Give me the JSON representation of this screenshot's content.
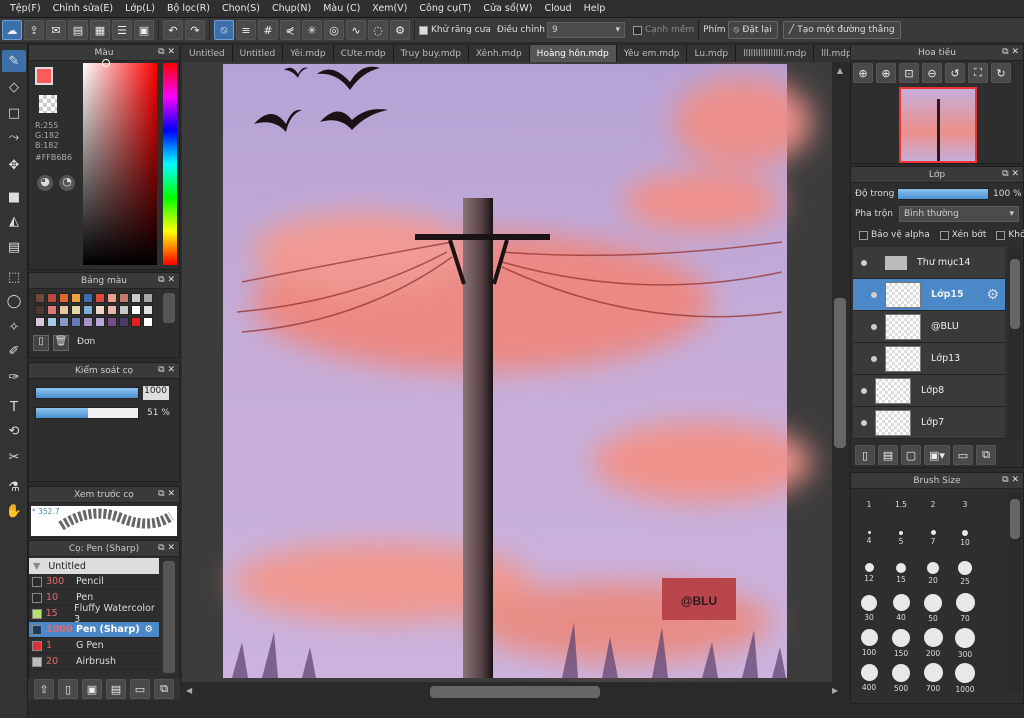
{
  "menu": [
    "Tệp(F)",
    "Chỉnh sửa(E)",
    "Lớp(L)",
    "Bộ lọc(R)",
    "Chọn(S)",
    "Chụp(N)",
    "Màu (C)",
    "Xem(V)",
    "Công cụ(T)",
    "Cửa sổ(W)",
    "Cloud",
    "Help"
  ],
  "toolbar": {
    "antialias": "Khử răng cưa",
    "adjust_label": "Điều chỉnh",
    "adjust_value": "9",
    "soft_edge": "Cạnh mềm",
    "key_label": "Phím",
    "reset": "Đặt lại",
    "straight": "Tạo một đường thẳng"
  },
  "color_panel": {
    "title": "Màu",
    "r": "R:255",
    "g": "G:182",
    "b": "B:182",
    "hex": "#FFB6B6",
    "primary": "#ff5a5a"
  },
  "palette_panel": {
    "title": "Bảng màu",
    "mode": "Đơn"
  },
  "brush_control": {
    "title": "Kiểm soát cọ",
    "size": "1000",
    "opacity": "51 %",
    "opacity_pct": 51
  },
  "preview": {
    "title": "Xem trước cọ",
    "value": "* 352.7"
  },
  "brush_list": {
    "title": "Cọ: Pen (Sharp)",
    "group": "Untitled",
    "items": [
      {
        "size": "300",
        "name": "Pencil",
        "color": "#2a2a2a"
      },
      {
        "size": "10",
        "name": "Pen",
        "color": "#2a2a2a"
      },
      {
        "size": "15",
        "name": "Fluffy Watercolor 3",
        "color": "#b5e36a"
      },
      {
        "size": "1000",
        "name": "Pen (Sharp)",
        "color": "#1b3a5e",
        "sel": true
      },
      {
        "size": "1",
        "name": "G Pen",
        "color": "#e03030"
      },
      {
        "size": "20",
        "name": "Airbrush",
        "color": "#bbbbbb"
      }
    ]
  },
  "tabs": [
    "Untitled",
    "Untitled",
    "Yêi.mdp",
    "CUte.mdp",
    "Truy buy.mdp",
    "Xênh.mdp",
    "Hoàng hôn.mdp",
    "Yêu em.mdp",
    "Lu.mdp",
    "llllllllllllllll.mdp",
    "lll.mdp"
  ],
  "active_tab": 6,
  "canvas": {
    "watermark": "@BLU"
  },
  "navigator": {
    "title": "Hoa tiêu"
  },
  "layer_panel": {
    "title": "Lớp",
    "opacity_label": "Độ trong",
    "opacity_value": "100 %",
    "blend_label": "Pha trộn",
    "blend_value": "Bình thường",
    "protect_alpha": "Bảo vệ alpha",
    "clip": "Xén bớt",
    "lock": "Khóa",
    "layers": [
      {
        "name": "Thư mục14",
        "folder": true
      },
      {
        "name": "Lớp15",
        "sel": true,
        "sub": true
      },
      {
        "name": "@BLU",
        "sub": true
      },
      {
        "name": "Lớp13",
        "sub": true
      },
      {
        "name": "Lớp8"
      },
      {
        "name": "Lớp7"
      }
    ]
  },
  "brush_size": {
    "title": "Brush Size",
    "sizes": [
      "1",
      "1.5",
      "2",
      "3",
      "4",
      "5",
      "7",
      "10",
      "12",
      "15",
      "20",
      "25",
      "30",
      "40",
      "50",
      "70",
      "100",
      "150",
      "200",
      "300",
      "400",
      "500",
      "700",
      "1000"
    ]
  }
}
